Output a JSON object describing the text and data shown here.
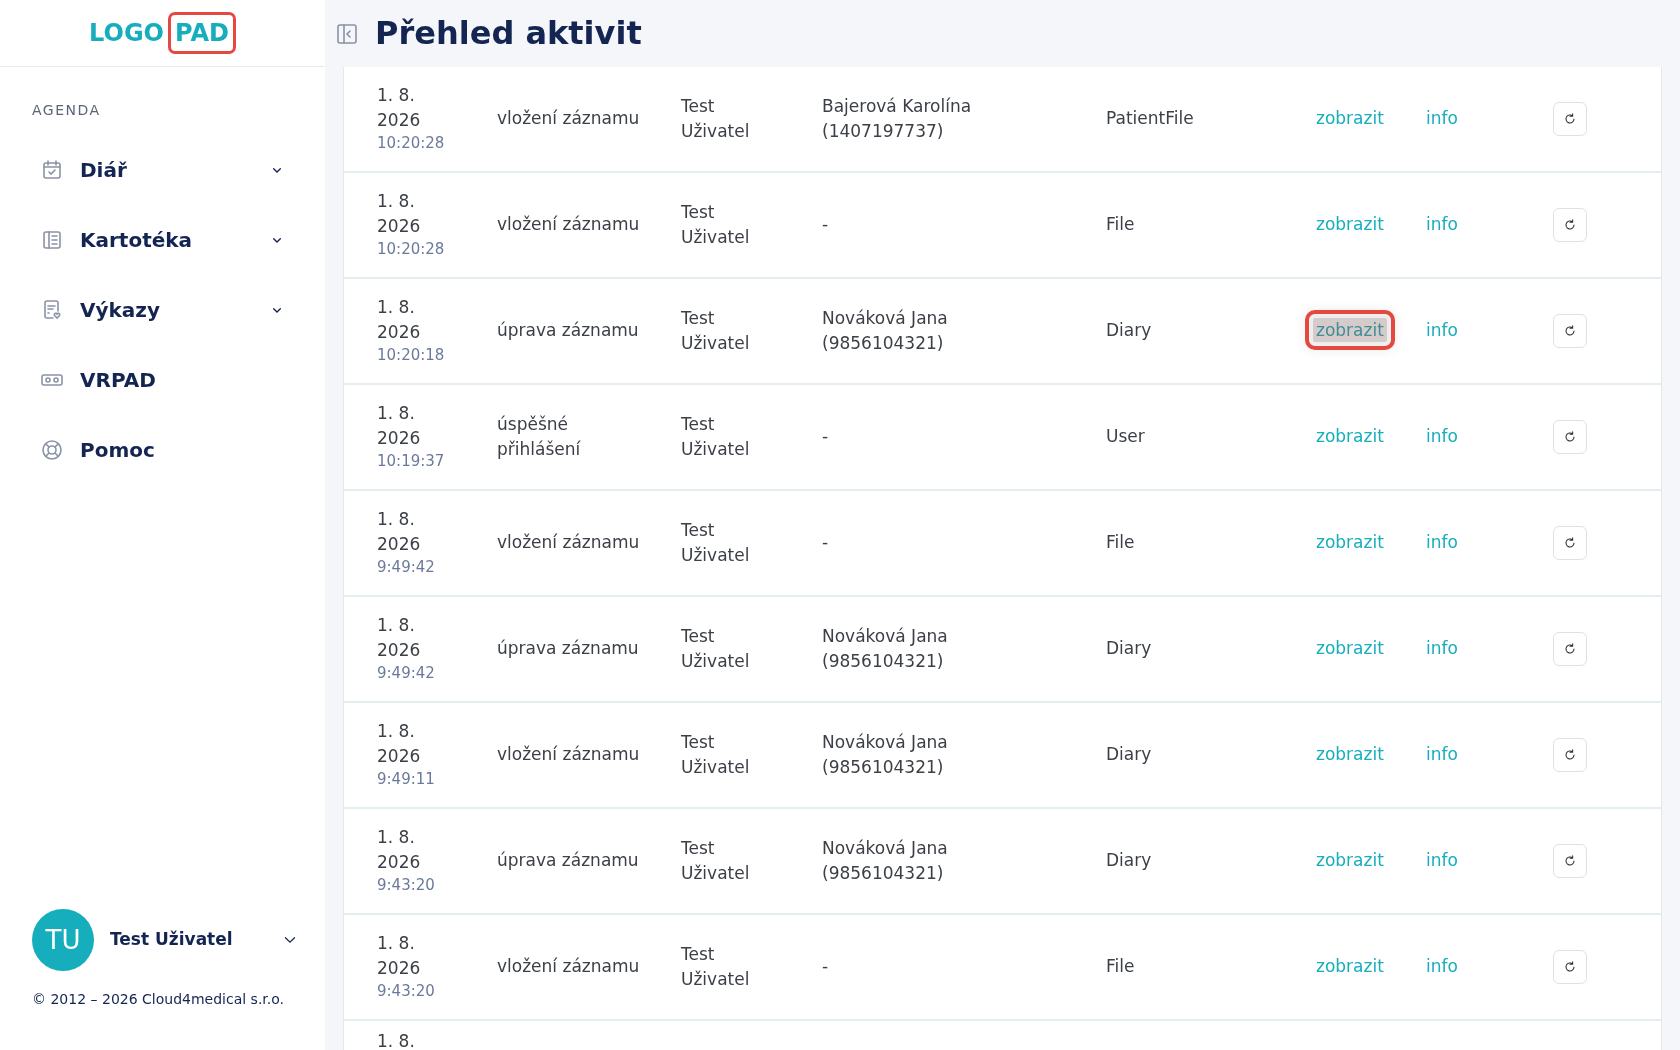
{
  "logo": {
    "part_1": "LOGO",
    "part_2": "PAD"
  },
  "page_title": "Přehled aktivit",
  "sidebar": {
    "section_label": "AGENDA",
    "items": [
      {
        "label": "Diář",
        "kind": "calendar",
        "expandable": true
      },
      {
        "label": "Kartotéka",
        "kind": "cards",
        "expandable": true
      },
      {
        "label": "Výkazy",
        "kind": "report",
        "expandable": true
      },
      {
        "label": "VRPAD",
        "kind": "vr",
        "expandable": false
      },
      {
        "label": "Pomoc",
        "kind": "help",
        "expandable": false
      }
    ]
  },
  "user": {
    "initials": "TU",
    "name": "Test Uživatel"
  },
  "footer": "© 2012 – 2026 Cloud4medical s.r.o.",
  "rows": [
    {
      "date": "1. 8.",
      "year": "2026",
      "time": "10:20:28",
      "action": "vložení záznamu",
      "user": "Test Uživatel",
      "patient": "Bajerová Karolína (1407197737)",
      "entity": "PatientFile",
      "view": "zobrazit",
      "info": "info",
      "highlighted": false
    },
    {
      "date": "1. 8.",
      "year": "2026",
      "time": "10:20:28",
      "action": "vložení záznamu",
      "user": "Test Uživatel",
      "patient": "-",
      "entity": "File",
      "view": "zobrazit",
      "info": "info",
      "highlighted": false
    },
    {
      "date": "1. 8.",
      "year": "2026",
      "time": "10:20:18",
      "action": "úprava záznamu",
      "user": "Test Uživatel",
      "patient": "Nováková Jana (9856104321)",
      "entity": "Diary",
      "view": "zobrazit",
      "info": "info",
      "highlighted": true
    },
    {
      "date": "1. 8.",
      "year": "2026",
      "time": "10:19:37",
      "action": "úspěšné přihlášení",
      "user": "Test Uživatel",
      "patient": "-",
      "entity": "User",
      "view": "zobrazit",
      "info": "info",
      "highlighted": false
    },
    {
      "date": "1. 8.",
      "year": "2026",
      "time": "9:49:42",
      "action": "vložení záznamu",
      "user": "Test Uživatel",
      "patient": "-",
      "entity": "File",
      "view": "zobrazit",
      "info": "info",
      "highlighted": false
    },
    {
      "date": "1. 8.",
      "year": "2026",
      "time": "9:49:42",
      "action": "úprava záznamu",
      "user": "Test Uživatel",
      "patient": "Nováková Jana (9856104321)",
      "entity": "Diary",
      "view": "zobrazit",
      "info": "info",
      "highlighted": false
    },
    {
      "date": "1. 8.",
      "year": "2026",
      "time": "9:49:11",
      "action": "vložení záznamu",
      "user": "Test Uživatel",
      "patient": "Nováková Jana (9856104321)",
      "entity": "Diary",
      "view": "zobrazit",
      "info": "info",
      "highlighted": false
    },
    {
      "date": "1. 8.",
      "year": "2026",
      "time": "9:43:20",
      "action": "úprava záznamu",
      "user": "Test Uživatel",
      "patient": "Nováková Jana (9856104321)",
      "entity": "Diary",
      "view": "zobrazit",
      "info": "info",
      "highlighted": false
    },
    {
      "date": "1. 8.",
      "year": "2026",
      "time": "9:43:20",
      "action": "vložení záznamu",
      "user": "Test Uživatel",
      "patient": "-",
      "entity": "File",
      "view": "zobrazit",
      "info": "info",
      "highlighted": false
    },
    {
      "date": "1. 8."
    }
  ]
}
